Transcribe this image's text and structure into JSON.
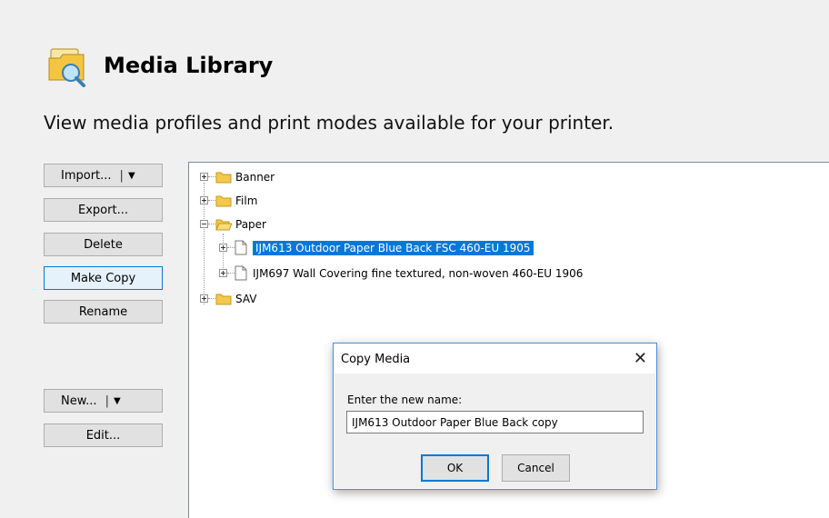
{
  "header": {
    "title": "Media Library",
    "subtitle": "View media profiles and print modes available for your printer.",
    "icon": "media-library-icon"
  },
  "actions": {
    "import_label": "Import...",
    "export_label": "Export...",
    "delete_label": "Delete",
    "make_copy_label": "Make Copy",
    "rename_label": "Rename",
    "new_label": "New...",
    "edit_label": "Edit..."
  },
  "tree": {
    "folders": [
      {
        "label": "Banner",
        "expanded": false
      },
      {
        "label": "Film",
        "expanded": false
      },
      {
        "label": "Paper",
        "expanded": true
      },
      {
        "label": "SAV",
        "expanded": false
      }
    ],
    "paper_items": [
      {
        "label": "IJM613 Outdoor Paper Blue Back  FSC 460-EU 1905",
        "selected": true
      },
      {
        "label": "IJM697 Wall Covering fine textured, non-woven 460-EU 1906",
        "selected": false
      }
    ]
  },
  "dialog": {
    "title": "Copy Media",
    "prompt": "Enter the new name:",
    "input_value": "IJM613 Outdoor Paper Blue Back copy",
    "ok_label": "OK",
    "cancel_label": "Cancel"
  },
  "colors": {
    "selection": "#0078d7",
    "folder": "#e8b83a",
    "background": "#f0f0f0"
  }
}
